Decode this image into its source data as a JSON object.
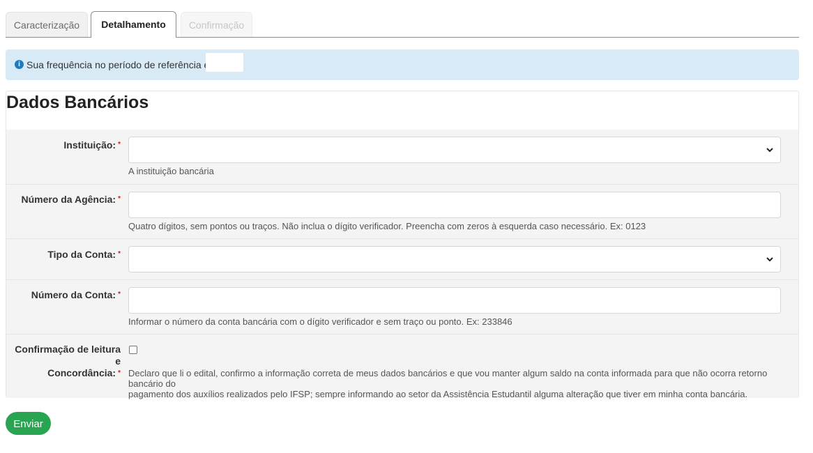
{
  "tabs": [
    {
      "label": "Caracterização",
      "state": "inactive"
    },
    {
      "label": "Detalhamento",
      "state": "active"
    },
    {
      "label": "Confirmação",
      "state": "disabled"
    }
  ],
  "alert": {
    "icon": "info-icon",
    "text": "Sua frequência no período de referência é de",
    "value": ""
  },
  "section": {
    "title": "Dados Bancários"
  },
  "form": {
    "instituicao": {
      "label": "Instituição:",
      "required": "*",
      "value": "",
      "help": "A instituição bancária"
    },
    "agencia": {
      "label": "Número da Agência:",
      "required": "*",
      "value": "",
      "help": "Quatro dígitos, sem pontos ou traços. Não inclua o dígito verificador. Preencha com zeros à esquerda caso necessário. Ex: 0123"
    },
    "tipo_conta": {
      "label": "Tipo da Conta:",
      "required": "*",
      "value": ""
    },
    "numero_conta": {
      "label": "Número da Conta:",
      "required": "*",
      "value": "",
      "help": "Informar o número da conta bancária com o dígito verificador e sem traço ou ponto. Ex: 233846"
    },
    "confirmacao": {
      "label_line1": "Confirmação de leitura e",
      "label_line2": "Concordância:",
      "required": "*",
      "checked": false,
      "help_line1": "Declaro que li o edital, confirmo a informação correta de meus dados bancários e que vou manter algum saldo na conta informada para que não ocorra retorno bancário do",
      "help_line2": "pagamento dos auxílios realizados pelo IFSP; sempre informando ao setor da Assistência Estudantil alguma alteração que tiver em minha conta bancária."
    }
  },
  "submit": {
    "label": "Enviar"
  },
  "colors": {
    "primary_button": "#29a552",
    "alert_bg": "#d8eaf6",
    "info_icon": "#1f7bc0",
    "required": "#cc2222"
  }
}
